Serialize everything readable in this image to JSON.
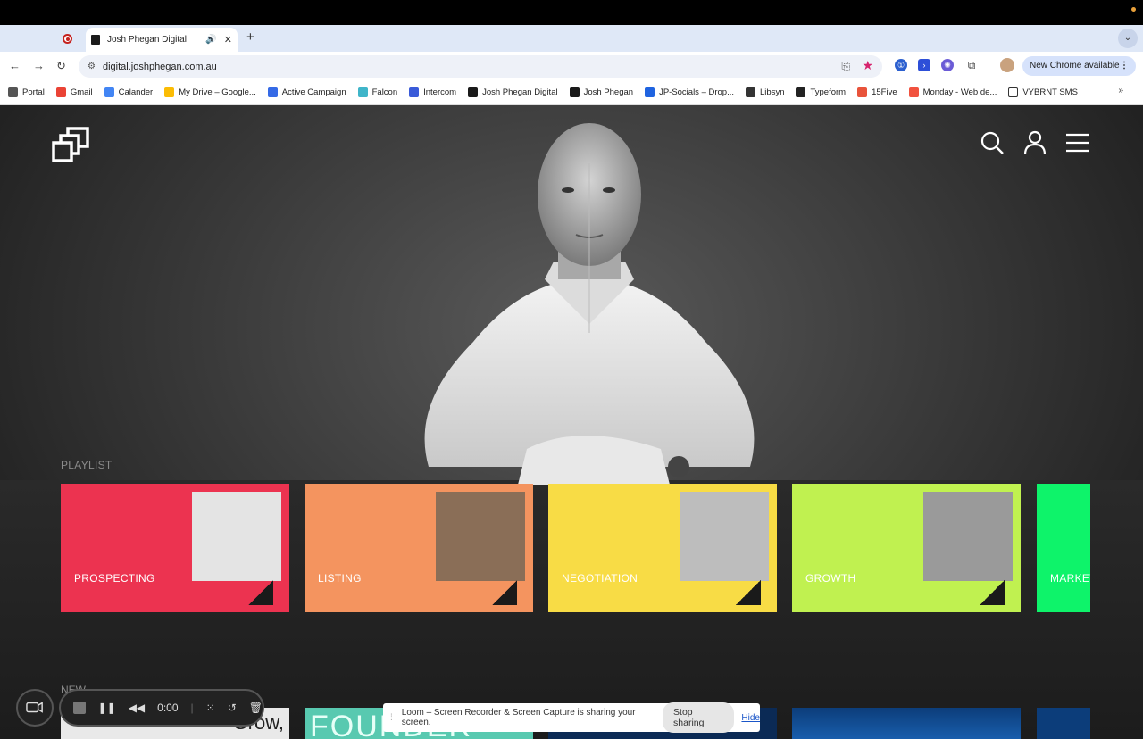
{
  "browser": {
    "tab_title": "Josh Phegan Digital",
    "new_tab_label": "+",
    "url": "digital.joshphegan.com.au",
    "update_label": "New Chrome available",
    "bookmarks": [
      {
        "label": "Portal",
        "color": "#555555"
      },
      {
        "label": "Gmail",
        "color": "#ea4335"
      },
      {
        "label": "Calander",
        "color": "#4285f4"
      },
      {
        "label": "My Drive – Google...",
        "color": "#fbbc04"
      },
      {
        "label": "Active Campaign",
        "color": "#356ae6"
      },
      {
        "label": "Falcon",
        "color": "#3fb5c9"
      },
      {
        "label": "Intercom",
        "color": "#3a5bd9"
      },
      {
        "label": "Josh Phegan Digital",
        "color": "#1a1a1a"
      },
      {
        "label": "Josh Phegan",
        "color": "#1a1a1a"
      },
      {
        "label": "JP-Socials – Drop...",
        "color": "#1f63e0"
      },
      {
        "label": "Libsyn",
        "color": "#333333"
      },
      {
        "label": "Typeform",
        "color": "#222222"
      },
      {
        "label": "15Five",
        "color": "#e8533b"
      },
      {
        "label": "Monday - Web de...",
        "color": "#f1523f"
      },
      {
        "label": "VYBRNT SMS",
        "color": "#ffffff"
      }
    ]
  },
  "site": {
    "playlist_label": "PLAYLIST",
    "new_label": "NEW",
    "cards": [
      {
        "label": "PROSPECTING",
        "color": "#ec3350"
      },
      {
        "label": "LISTING",
        "color": "#f4945f"
      },
      {
        "label": "NEGOTIATION",
        "color": "#f8dc45"
      },
      {
        "label": "GROWTH",
        "color": "#c0f150"
      },
      {
        "label": "MARKETING",
        "color": "#0ef36a"
      }
    ],
    "new_thumbs": [
      {
        "text": "Grow,"
      },
      {
        "text": "FOUNDER"
      }
    ]
  },
  "loom": {
    "time": "0:00",
    "share_message": "Loom – Screen Recorder & Screen Capture is sharing your screen.",
    "stop_label": "Stop sharing",
    "hide_label": "Hide"
  }
}
